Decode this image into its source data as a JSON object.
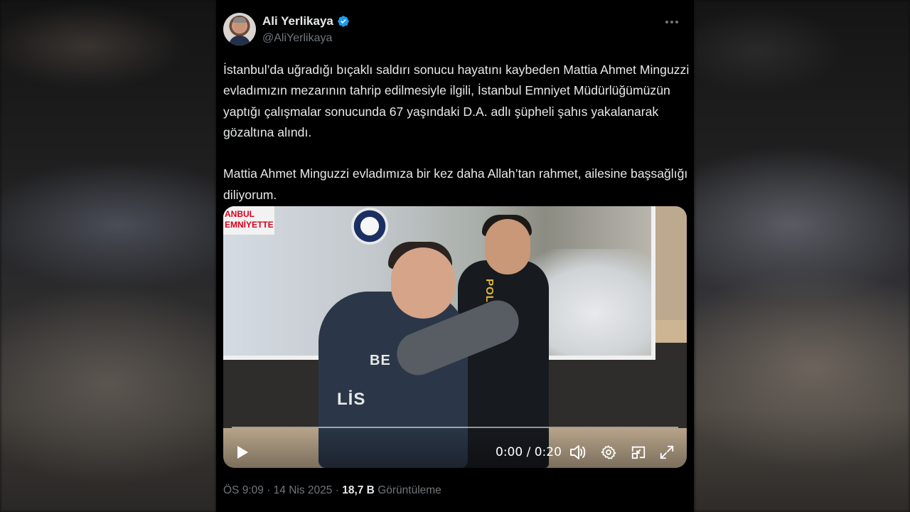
{
  "tweet": {
    "author": {
      "display_name": "Ali Yerlikaya",
      "handle": "@AliYerlikaya",
      "verified": true
    },
    "text_paragraphs": [
      "İstanbul’da uğradığı bıçaklı saldırı sonucu hayatını kaybeden Mattia Ahmet Minguzzi evladımızın mezarının tahrip edilmesiyle ilgili, İstanbul Emniyet Müdürlüğümüzün yaptığı çalışmalar sonucunda 67 yaşındaki D.A. adlı şüpheli şahıs yakalanarak gözaltına alındı.",
      "Mattia Ahmet Minguzzi evladımıza bir kez daha Allah’tan rahmet, ailesine başsağlığı diliyorum."
    ],
    "media": {
      "type": "video",
      "poster_banner_text": "ANBUL EMNİYETTE",
      "vest_text_back": "BE",
      "vest_text_side": "LİS",
      "vest_text_front": "POL",
      "player": {
        "current_time": "0:00",
        "duration": "0:20",
        "time_display": "0:00 / 0:20",
        "progress_fraction": 0,
        "controls": [
          "play-icon",
          "volume-icon",
          "settings-icon",
          "pip-icon",
          "fullscreen-icon"
        ]
      }
    },
    "meta": {
      "time": "ÖS 9:09",
      "separator": "·",
      "date": "14 Nis 2025",
      "views_count": "18,7 B",
      "views_label": "Görüntüleme"
    }
  },
  "colors": {
    "background": "#000000",
    "text_primary": "#e7e9ea",
    "text_secondary": "#71767b",
    "verified_badge": "#1d9bf0"
  }
}
